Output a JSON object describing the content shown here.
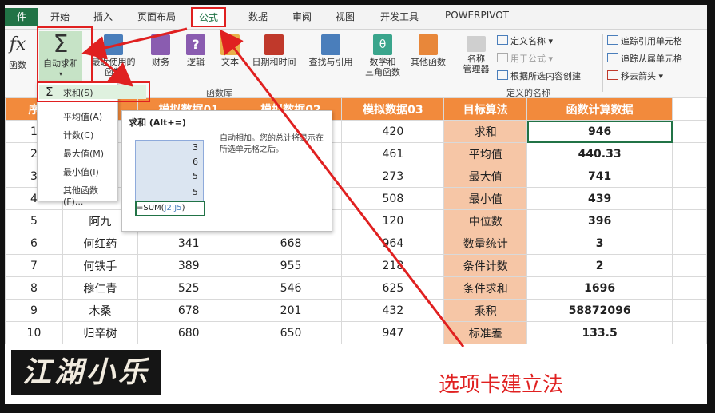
{
  "tabs": {
    "file": "件",
    "items": [
      "开始",
      "插入",
      "页面布局",
      "公式",
      "数据",
      "审阅",
      "视图",
      "开发工具",
      "POWERPIVOT"
    ],
    "active": "公式"
  },
  "ribbon": {
    "insert_fn_label": "函数",
    "autosum_label": "自动求和",
    "recent_label": "最近使用的",
    "recent_label2": "函数",
    "finance_label": "财务",
    "logic_label": "逻辑",
    "text_label": "文本",
    "datetime_label": "日期和时间",
    "lookup_label": "查找与引用",
    "math_label": "数学和",
    "math_label2": "三角函数",
    "more_label": "其他函数",
    "fx_symbol": "fx",
    "sigma_symbol": "Σ",
    "group_function_library": "函数库",
    "name_manager_label": "名称",
    "name_manager_label2": "管理器",
    "define_name": "定义名称",
    "use_in_formula": "用于公式",
    "create_from_selection": "根据所选内容创建",
    "group_defined_names": "定义的名称",
    "trace_precedents": "追踪引用单元格",
    "trace_dependents": "追踪从属单元格",
    "remove_arrows": "移去箭头"
  },
  "dropdown": {
    "sum": "求和(S)",
    "average": "平均值(A)",
    "count": "计数(C)",
    "max": "最大值(M)",
    "min": "最小值(I)",
    "more": "其他函数(F)..."
  },
  "tooltip": {
    "title": "求和 (Alt+=)",
    "description": "自动相加。您的总计将显示在所选单元格之后。",
    "sample_values": [
      "3",
      "6",
      "5",
      "5"
    ],
    "formula_prefix": "=SUM(",
    "formula_ref": "J2:J5",
    "formula_suffix": ")"
  },
  "sheet": {
    "header_visible": [
      "序",
      "模拟数据01",
      "模拟数据02",
      "模拟数据03",
      "目标算法",
      "函数计算数据"
    ],
    "rows": [
      {
        "n": "1",
        "name": "",
        "a": "",
        "b": "",
        "c": "420",
        "calc": "求和",
        "result": "946"
      },
      {
        "n": "2",
        "name": "",
        "a": "",
        "b": "",
        "c": "461",
        "calc": "平均值",
        "result": "440.33"
      },
      {
        "n": "3",
        "name": "",
        "a": "",
        "b": "",
        "c": "273",
        "calc": "最大值",
        "result": "741"
      },
      {
        "n": "4",
        "name": "",
        "a": "",
        "b": "",
        "c": "508",
        "calc": "最小值",
        "result": "439"
      },
      {
        "n": "5",
        "name": "阿九",
        "a": "",
        "b": "",
        "c": "120",
        "calc": "中位数",
        "result": "396"
      },
      {
        "n": "6",
        "name": "何红药",
        "a": "341",
        "b": "668",
        "c": "964",
        "calc": "数量统计",
        "result": "3"
      },
      {
        "n": "7",
        "name": "何铁手",
        "a": "389",
        "b": "955",
        "c": "218",
        "calc": "条件计数",
        "result": "2"
      },
      {
        "n": "8",
        "name": "穆仁青",
        "a": "525",
        "b": "546",
        "c": "625",
        "calc": "条件求和",
        "result": "1696"
      },
      {
        "n": "9",
        "name": "木桑",
        "a": "678",
        "b": "201",
        "c": "432",
        "calc": "乘积",
        "result": "58872096"
      },
      {
        "n": "10",
        "name": "归辛树",
        "a": "680",
        "b": "650",
        "c": "947",
        "calc": "标准差",
        "result": "133.5"
      }
    ]
  },
  "overlay": {
    "brand": "江湖小乐",
    "caption": "选项卡建立法"
  },
  "colors": {
    "excel_green": "#217346",
    "header_orange": "#f28a3c",
    "calc_peach": "#f6c6a6",
    "annotation_red": "#e02020"
  }
}
